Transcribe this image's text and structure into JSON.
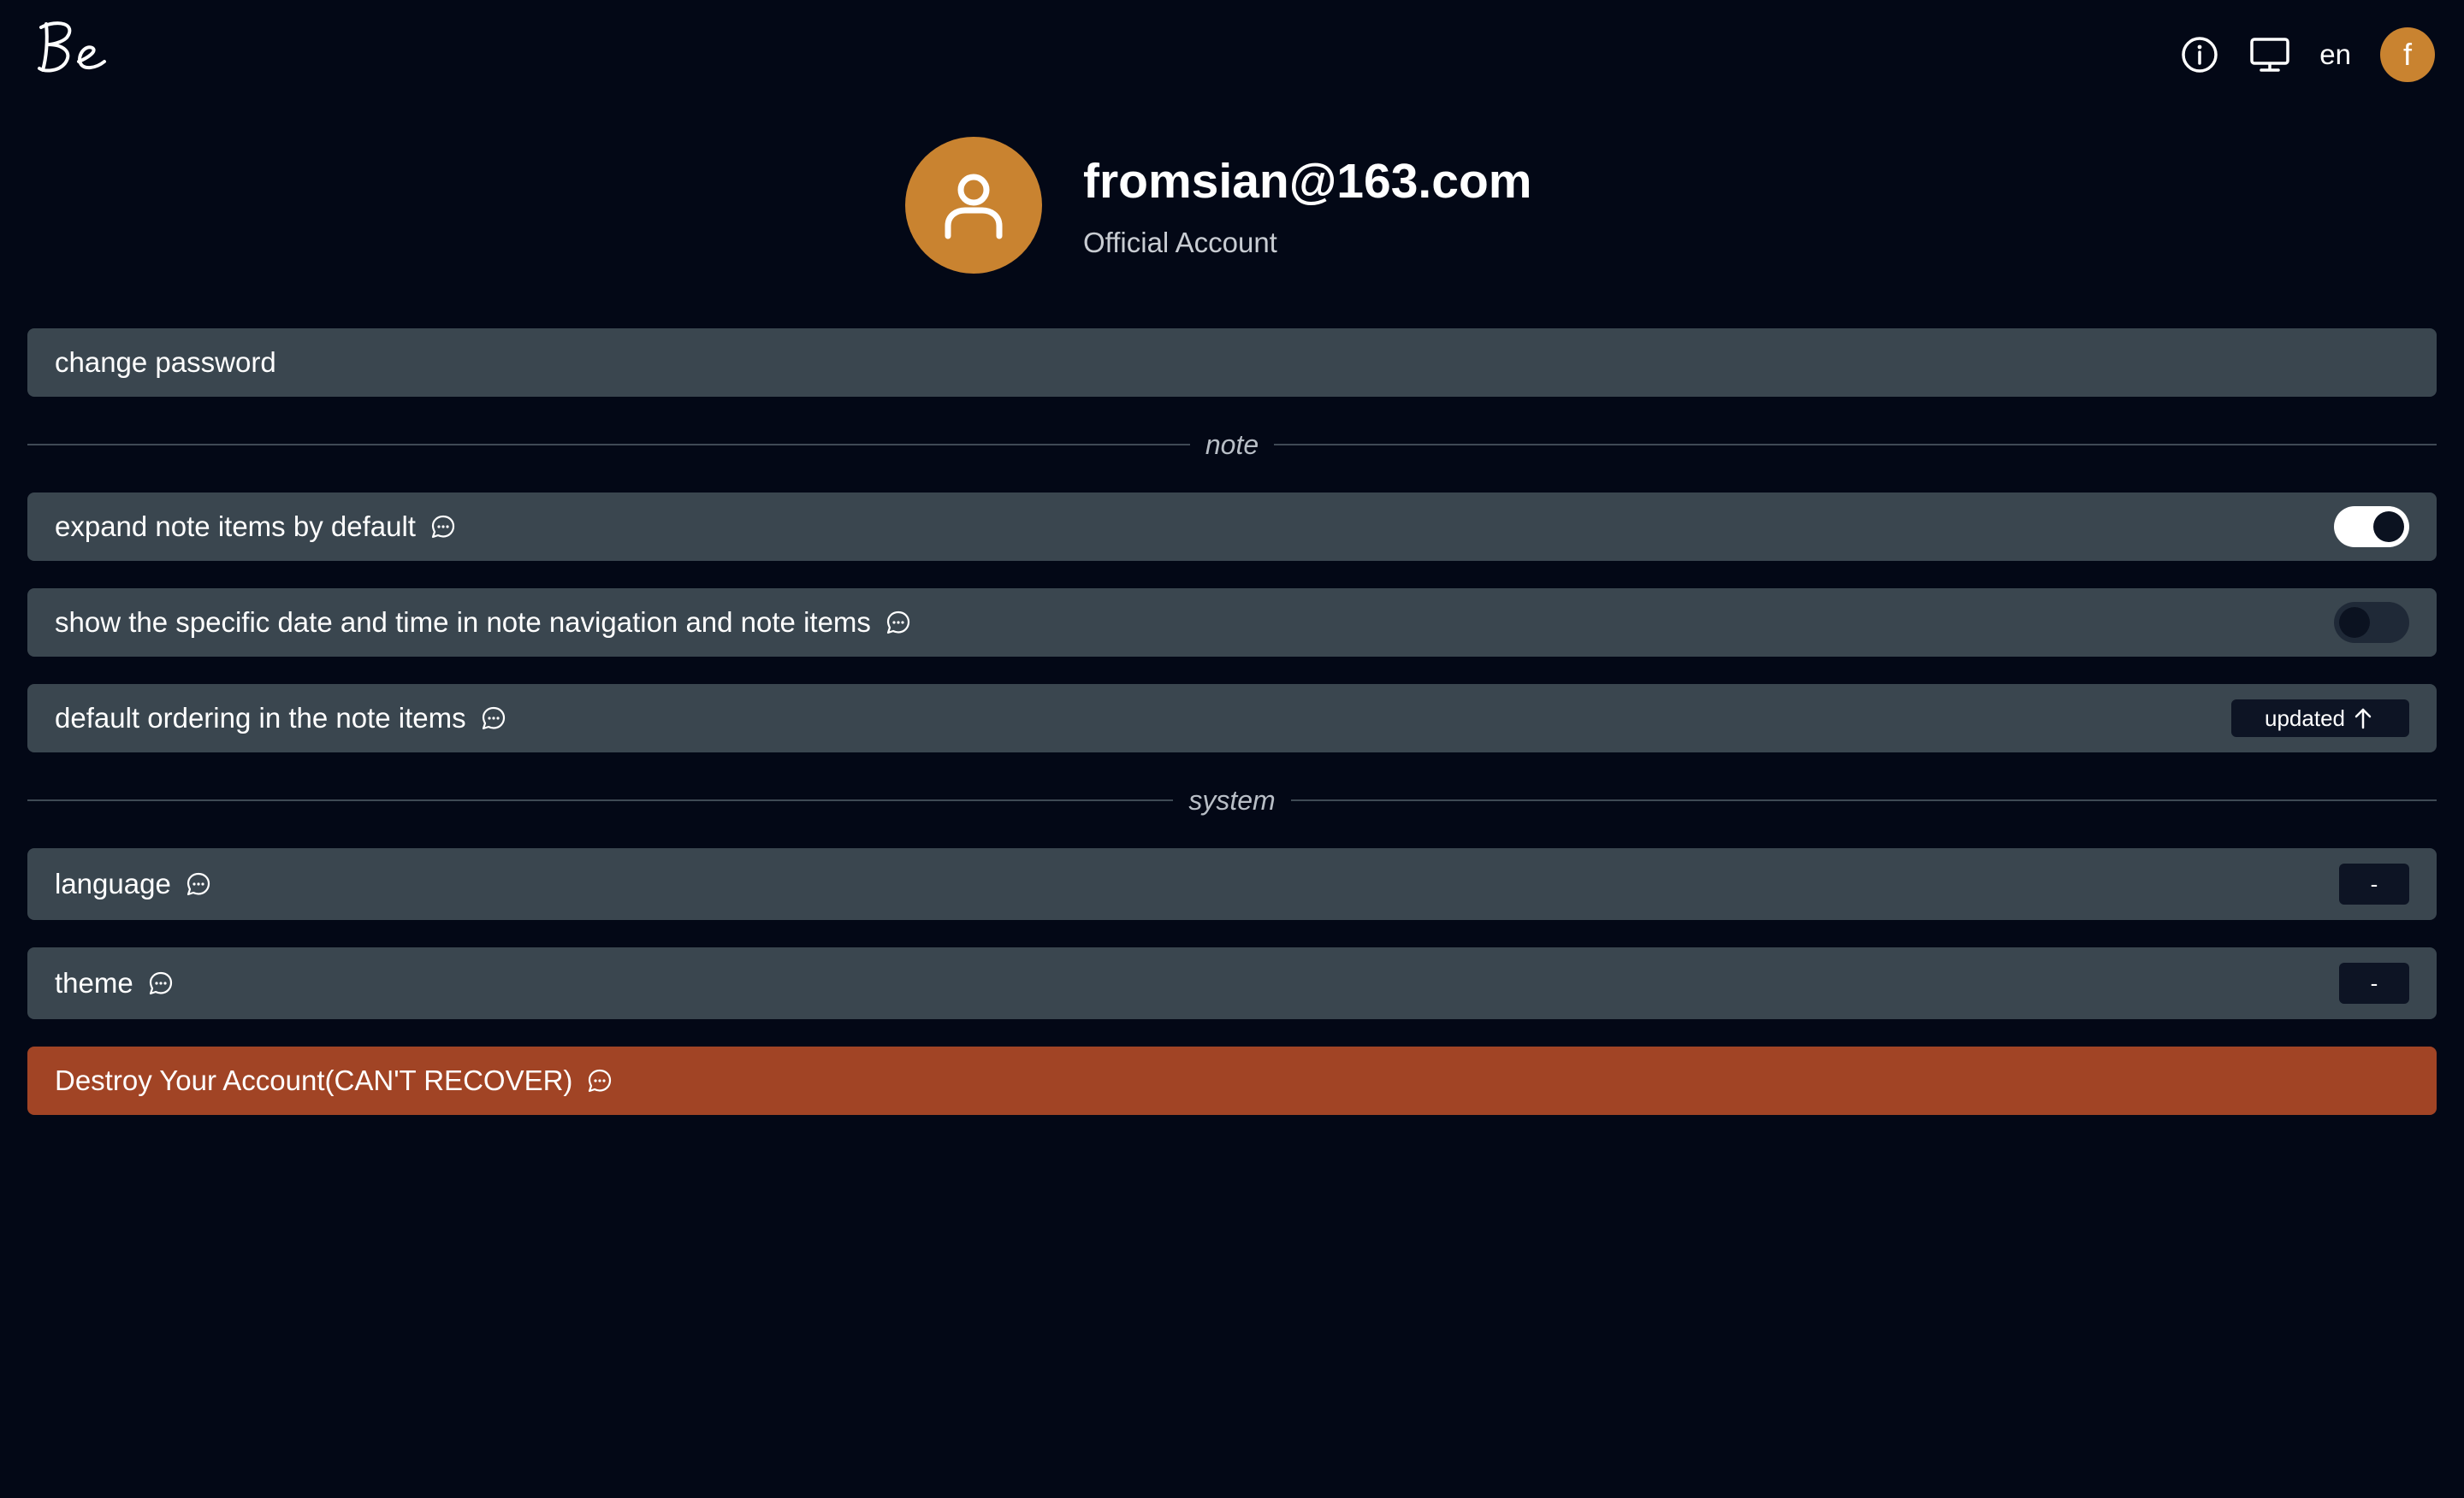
{
  "header": {
    "logo_text": "Be",
    "icons": [
      "info-icon",
      "monitor-icon"
    ],
    "language": "en",
    "user_initial": "f"
  },
  "profile": {
    "email": "fromsian@163.com",
    "role": "Official Account"
  },
  "actions": {
    "change_password": "change password",
    "destroy_account": "Destroy Your Account(CAN'T RECOVER)"
  },
  "sections": {
    "note": "note",
    "system": "system"
  },
  "settings": {
    "expand_note_items": {
      "label": "expand note items by default",
      "enabled": true
    },
    "show_date_time": {
      "label": "show the specific date and time in note navigation and note items",
      "enabled": false
    },
    "default_ordering": {
      "label": "default ordering in the note items",
      "value": "updated",
      "direction": "ascending"
    },
    "language": {
      "label": "language",
      "value": "-"
    },
    "theme": {
      "label": "theme",
      "value": "-"
    }
  },
  "colors": {
    "background": "#030816",
    "row": "#3a464f",
    "accent": "#c98330",
    "danger": "#a14425",
    "button": "#0d1424"
  }
}
